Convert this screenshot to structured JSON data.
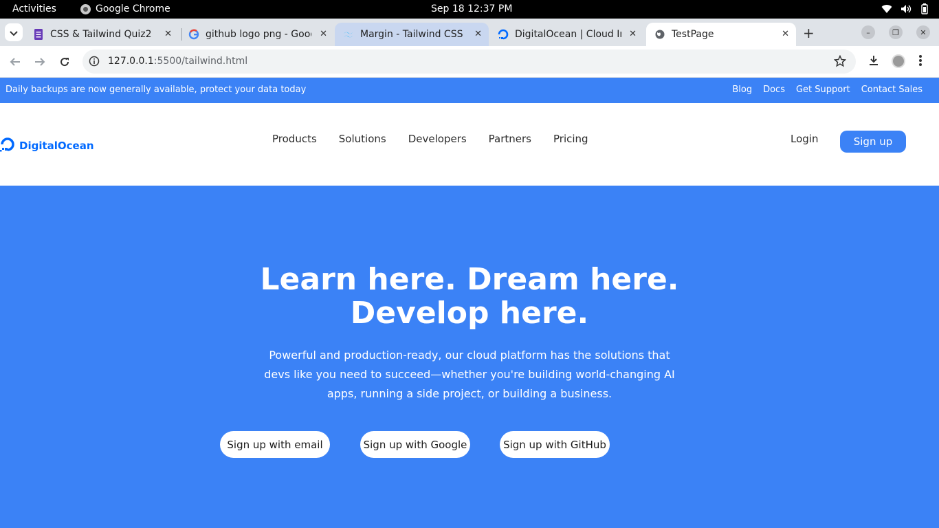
{
  "os_bar": {
    "activities": "Activities",
    "app_name": "Google Chrome",
    "clock": "Sep 18  12:37 PM"
  },
  "tabs": [
    {
      "title": "CSS & Tailwind Quiz2",
      "favicon": "forms-icon"
    },
    {
      "title": "github logo png - Goog",
      "favicon": "google-icon"
    },
    {
      "title": "Margin - Tailwind CSS",
      "favicon": "tailwind-icon"
    },
    {
      "title": "DigitalOcean | Cloud In",
      "favicon": "digitalocean-icon"
    },
    {
      "title": "TestPage",
      "favicon": "globe-icon",
      "active": true
    }
  ],
  "address_bar": {
    "host": "127.0.0.1",
    "rest": ":5500/tailwind.html"
  },
  "banner": {
    "message": "Daily backups are now generally available, protect your data today",
    "links": [
      "Blog",
      "Docs",
      "Get Support",
      "Contact Sales"
    ]
  },
  "nav": {
    "logo_text": "DigitalOcean",
    "menu": [
      "Products",
      "Solutions",
      "Developers",
      "Partners",
      "Pricing"
    ],
    "login": "Login",
    "signup": "Sign up"
  },
  "hero": {
    "title_line1": "Learn here. Dream here.",
    "title_line2": "Develop here.",
    "description": "Powerful and production-ready, our cloud platform has the solutions that devs like you need to succeed—whether you're building world-changing AI apps, running a side project, or building a business.",
    "buttons": [
      "Sign up with email",
      "Sign up with Google",
      "Sign up with GitHub"
    ]
  },
  "colors": {
    "brand_blue": "#3b82f6",
    "logo_blue": "#0069ff"
  }
}
